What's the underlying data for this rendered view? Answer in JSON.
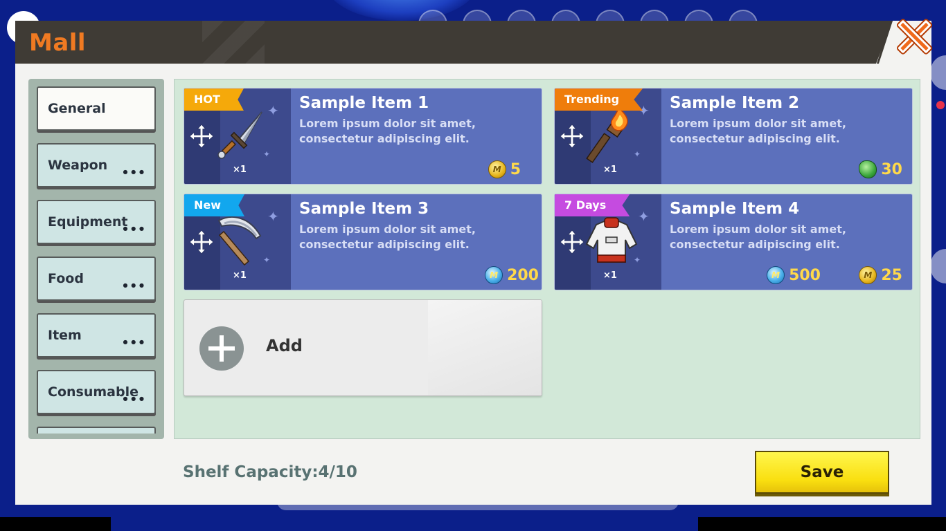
{
  "window": {
    "title": "Mall"
  },
  "categories": [
    {
      "label": "General",
      "active": true
    },
    {
      "label": "Weapon"
    },
    {
      "label": "Equipment"
    },
    {
      "label": "Food"
    },
    {
      "label": "Item"
    },
    {
      "label": "Consumable"
    }
  ],
  "items": [
    {
      "badge": "HOT",
      "badge_color": "#f5a90a",
      "name": "Sample Item 1",
      "desc": "Lorem ipsum dolor sit amet, consectetur adipiscing elit.",
      "qty": "×1",
      "icon": "dagger-icon",
      "prices": [
        {
          "currency": "gold-coin-icon",
          "amount": "5"
        }
      ]
    },
    {
      "badge": "Trending",
      "badge_color": "#ef7d0b",
      "name": "Sample Item 2",
      "desc": "Lorem ipsum dolor sit amet, consectetur adipiscing elit.",
      "qty": "×1",
      "icon": "torch-icon",
      "prices": [
        {
          "currency": "green-gem-icon",
          "amount": "30"
        }
      ]
    },
    {
      "badge": "New",
      "badge_color": "#12a7ee",
      "name": "Sample Item 3",
      "desc": "Lorem ipsum dolor sit amet, consectetur adipiscing elit.",
      "qty": "×1",
      "icon": "pickaxe-icon",
      "prices": [
        {
          "currency": "blue-coin-icon",
          "amount": "200"
        }
      ]
    },
    {
      "badge": "7 Days",
      "badge_color": "#c54be0",
      "name": "Sample Item 4",
      "desc": "Lorem ipsum dolor sit amet, consectetur adipiscing elit.",
      "qty": "×1",
      "icon": "jacket-icon",
      "prices": [
        {
          "currency": "blue-coin-icon",
          "amount": "500"
        },
        {
          "currency": "gold-coin-icon",
          "amount": "25"
        }
      ]
    }
  ],
  "add": {
    "label": "Add"
  },
  "footer": {
    "capacity": "Shelf Capacity:4/10",
    "save_label": "Save"
  }
}
